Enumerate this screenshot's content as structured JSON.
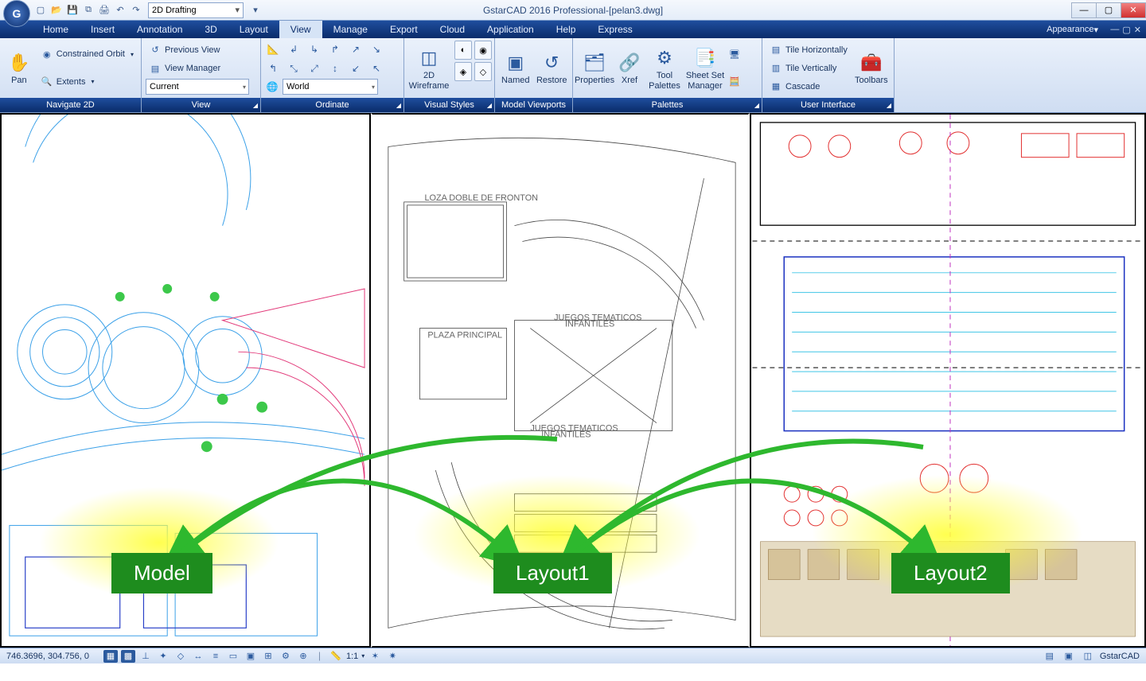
{
  "window": {
    "title": "GstarCAD 2016 Professional-[pelan3.dwg]"
  },
  "qat": {
    "workspace": "2D Drafting"
  },
  "menu": {
    "tabs": [
      "Home",
      "Insert",
      "Annotation",
      "3D",
      "Layout",
      "View",
      "Manage",
      "Export",
      "Cloud",
      "Application",
      "Help",
      "Express"
    ],
    "active": "View",
    "appearance_label": "Appearance"
  },
  "ribbon": {
    "navigate2d": {
      "title": "Navigate 2D",
      "pan": "Pan",
      "orbit": "Constrained Orbit",
      "extents": "Extents"
    },
    "view": {
      "title": "View",
      "prev": "Previous View",
      "mgr": "View Manager",
      "current": "Current"
    },
    "ordinate": {
      "title": "Ordinate",
      "world": "World"
    },
    "visual": {
      "title": "Visual Styles",
      "wf": "2D Wireframe"
    },
    "viewports": {
      "title": "Model Viewports",
      "named": "Named",
      "restore": "Restore"
    },
    "palettes": {
      "title": "Palettes",
      "props": "Properties",
      "xref": "Xref",
      "tool": "Tool Palettes",
      "sheet": "Sheet Set Manager"
    },
    "ui": {
      "title": "User Interface",
      "h": "Tile Horizontally",
      "v": "Tile Vertically",
      "c": "Cascade",
      "tb": "Toolbars"
    }
  },
  "viewports": {
    "v1_label": "Model",
    "v2_label": "Layout1",
    "v3_label": "Layout2",
    "v2_text1": "LOZA DOBLE DE FRONTON",
    "v2_text2": "PLAZA PRINCIPAL",
    "v2_text3": "JUEGOS TEMATICOS INFANTILES",
    "v2_text4": "JUEGOS TEMATICOS INFANTILES"
  },
  "status": {
    "coords": "746.3696, 304.756, 0",
    "scale": "1:1",
    "product": "GstarCAD"
  }
}
